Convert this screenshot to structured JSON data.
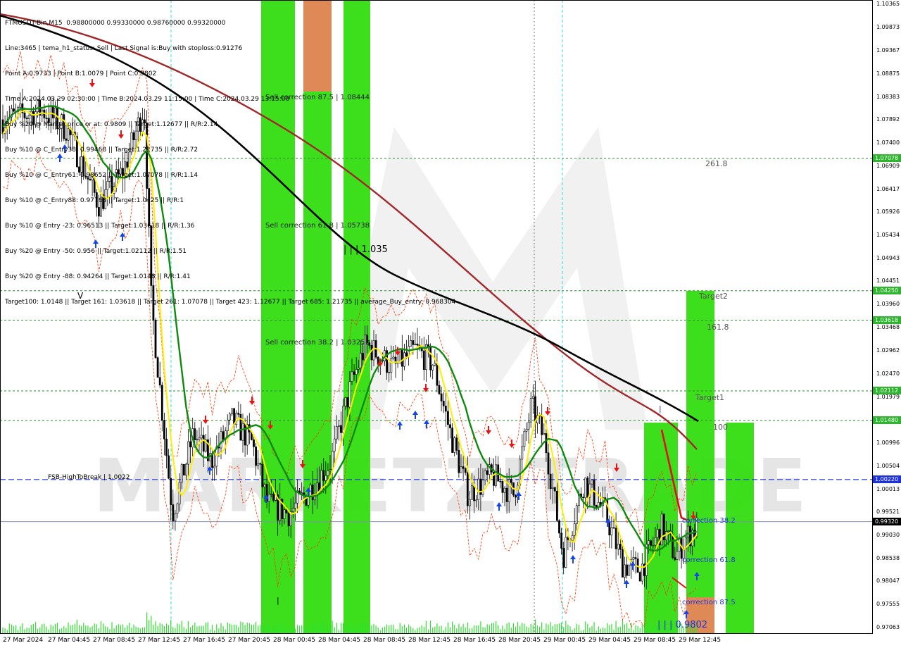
{
  "chart_data": {
    "type": "candlestick",
    "symbol": "FTMUSDT-Bin",
    "timeframe": "M15",
    "header": {
      "title": "FTMUSDT-Bin,M15  0.98800000 0.99330000 0.98760000 0.99320000",
      "lines": [
        "Line:3465 | tema_h1_status: Sell | Last Signal is:Buy with stoploss:0.91276",
        "Point A:0.9733 | Point B:1.0079 | Point C:0.9802",
        "Time A:2024.03.29 02:30:00 | Time B:2024.03.29 11:15:00 | Time C:2024.03.29 13:15:00",
        "Buy %20 @ Market price or at: 0.9809 || Target:1.12677 || R/R:2.14",
        "Buy %10 @ C_Entry38: 0.99468 || Target:1.21735 || R/R:2.72",
        "Buy %10 @ C_Entry61: 0.98652 || Target:1.07078 || R/R:1.14",
        "Buy %10 @ C_Entry88: 0.97763 || Target:1.0425 || R/R:1",
        "Buy %10 @ Entry -23: 0.96513 || Target:1.03618 || R/R:1.36",
        "Buy %20 @ Entry -50: 0.956 || Target:1.02112 || R/R:1.51",
        "Buy %20 @ Entry -88: 0.94264 || Target:1.0148 || R/R:1.41",
        "Target100: 1.0148 || Target 161: 1.03618 || Target 261: 1.07078 || Target 423: 1.12677 || Target 685: 1.21735 || average_Buy_entry: 0.968304"
      ]
    },
    "y_range": [
      0.96985,
      1.10365
    ],
    "y_ticks": [
      "1.10365",
      "1.09873",
      "1.09367",
      "1.08875",
      "1.08383",
      "1.07892",
      "1.07400",
      "1.06909",
      "1.06417",
      "1.05926",
      "1.05434",
      "1.04943",
      "1.04451",
      "1.03960",
      "1.03468",
      "1.02962",
      "1.02470",
      "1.01979",
      "1.00996",
      "1.00504",
      "1.00013",
      "0.99521",
      "0.99030",
      "0.98538",
      "0.98047",
      "0.97555",
      "0.97063"
    ],
    "x_labels": [
      "27 Mar 2024",
      "27 Mar 04:45",
      "27 Mar 08:45",
      "27 Mar 12:45",
      "27 Mar 16:45",
      "27 Mar 20:45",
      "28 Mar 00:45",
      "28 Mar 04:45",
      "28 Mar 08:45",
      "28 Mar 12:45",
      "28 Mar 16:45",
      "28 Mar 20:45",
      "29 Mar 00:45",
      "29 Mar 04:45",
      "29 Mar 08:45",
      "29 Mar 12:45"
    ],
    "level_tags": [
      {
        "text": "1.07078",
        "value": 1.07078,
        "color": "#2db52d"
      },
      {
        "text": "1.04250",
        "value": 1.0425,
        "color": "#2db52d"
      },
      {
        "text": "1.03618",
        "value": 1.03618,
        "color": "#2db52d"
      },
      {
        "text": "1.02112",
        "value": 1.02112,
        "color": "#2db52d"
      },
      {
        "text": "1.01480",
        "value": 1.0148,
        "color": "#2db52d"
      },
      {
        "text": "1.00220",
        "value": 1.0022,
        "color": "#1e33dd"
      },
      {
        "text": "0.99320",
        "value": 0.9932,
        "color": "#000000"
      }
    ],
    "annotations": {
      "sell_correction_875": "Sell correction 87.5 | 1.08444",
      "sell_correction_618": "Sell correction 61.8 | 1.05738",
      "sell_correction_382": "Sell correction 38.2 | 1.03252",
      "line_1035": "| | | 1.035",
      "fsb_high": "FSB-HighToBreak  |  1.0022",
      "fib_2618": "261.8",
      "target2": "Target2",
      "fib_1618": "161.8",
      "target1": "Target1",
      "fib_100": "100",
      "correction_382": "correction 38.2",
      "correction_618": "correction 61.8",
      "correction_875": "correction 87.5",
      "price_c": "| | | 0.9802",
      "marker_v": "V",
      "marker_bar": "|"
    },
    "watermark": "MARKETZITRADE"
  },
  "colors": {
    "background": "#ffffff",
    "bull_candle": "#000000",
    "zone_green": "#33dd11",
    "zone_salmon": "#e8845a",
    "tag_green": "#2db52d",
    "tag_blue": "#1e33dd",
    "ma_black": "#000000",
    "ma_brown": "#a0282a",
    "ma_green": "#0f8a0f",
    "ma_yellow": "#ffee00",
    "envelope": "#ff3300",
    "grid_dash": "#2a8a2a",
    "fsb_line": "#1e33dd",
    "buy_arrow": "#1444ee",
    "sell_arrow": "#ee1111",
    "volume": "#2ee02e"
  }
}
